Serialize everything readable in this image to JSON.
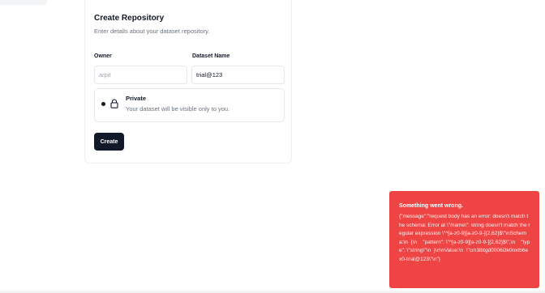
{
  "form": {
    "title": "Create Repository",
    "subtitle": "Enter details about your dataset repository.",
    "owner_label": "Owner",
    "owner_value": "arpit",
    "dataset_name_label": "Dataset Name",
    "dataset_name_value": "trial@123",
    "private_option": {
      "title": "Private",
      "description": "Your dataset will be visible only to you.",
      "icon": "lock-icon",
      "selected": true
    },
    "create_button": "Create"
  },
  "toast": {
    "title": "Something went wrong.",
    "message": "{\"message\":\"request body has an error: doesn't match the schema: Error at \\\"/name\\\": string doesn't match the regular expression \\\"^[a-z0-9][a-z0-9-]{2,62}$\\\"\\nSchema:\\n  {\\n    \"pattern\": \\\"^[a-z0-9][a-z0-9-]{2,62}$\\\",\\n    \"type\": \\\"string\\\"\\n  }\\n\\nValue:\\n  \\\"cm3lbtgd0006i3k0nxtb6ex0-trial@123\\\"\\n\"}",
    "background": "#ef4444"
  },
  "colors": {
    "primary_button": "#111827",
    "muted_text": "#6b7280"
  }
}
